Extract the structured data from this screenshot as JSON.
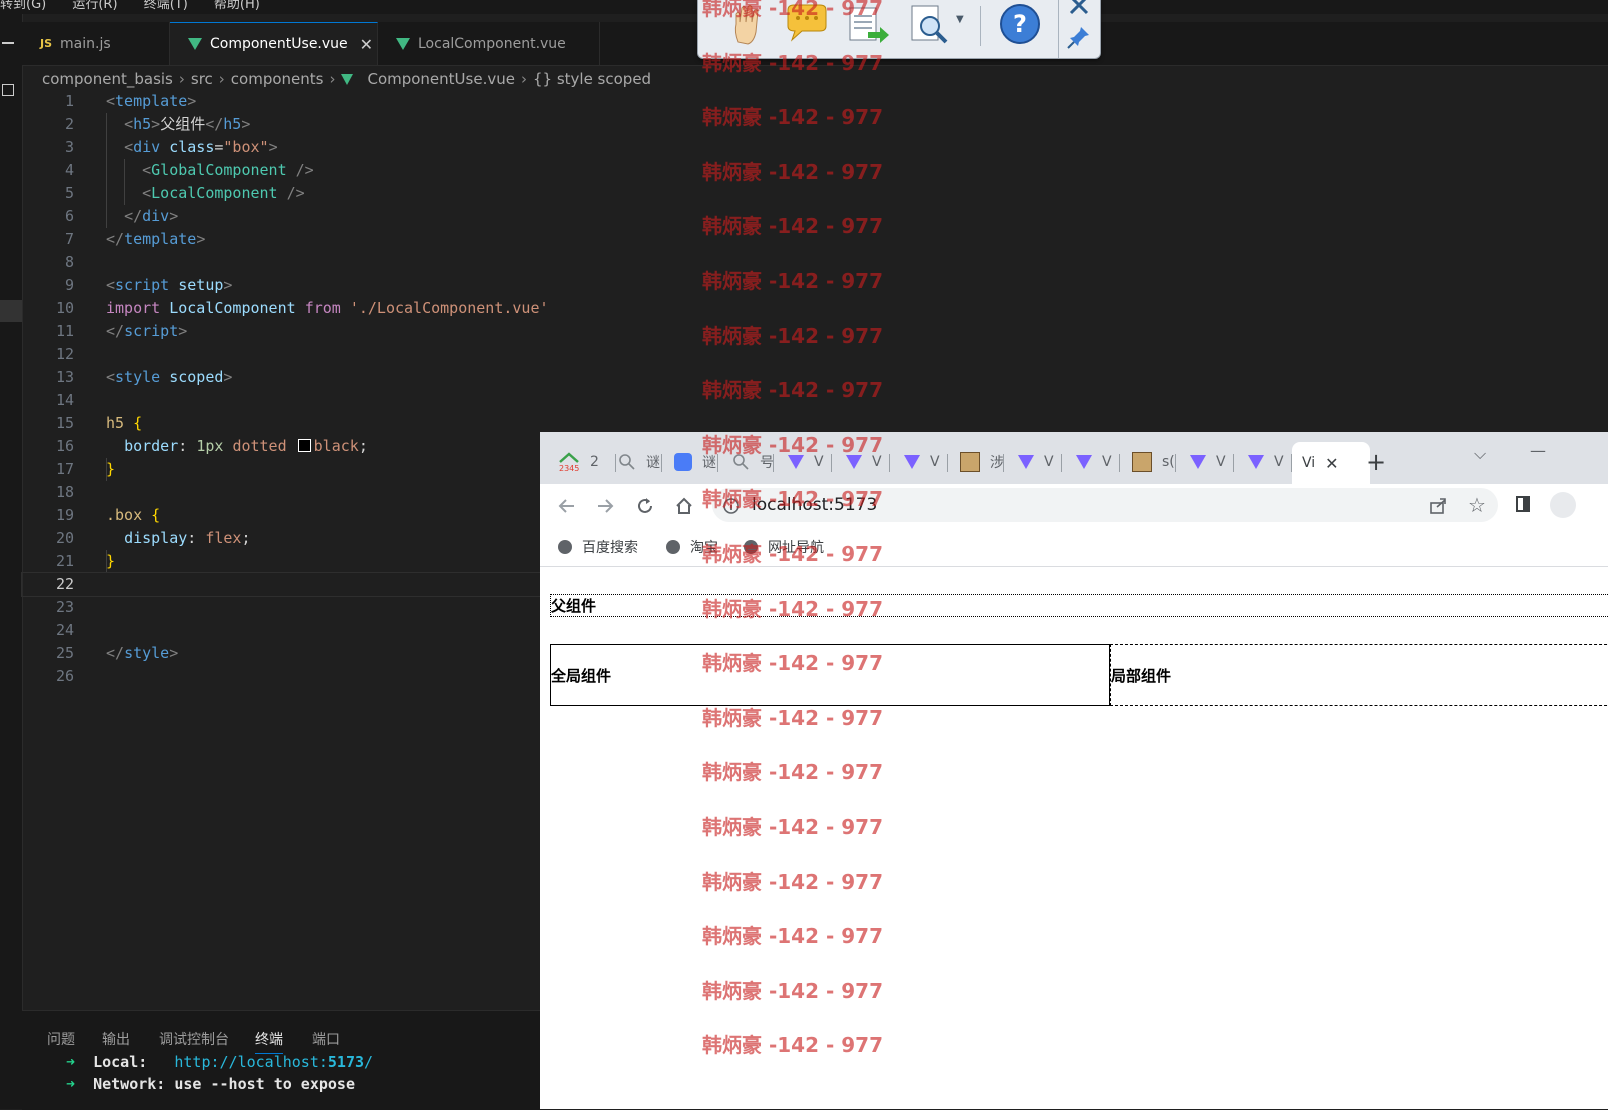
{
  "menubar": {
    "items": [
      "转到(G)",
      "运行(R)",
      "终端(T)",
      "帮助(H)"
    ]
  },
  "editor_tabs": [
    {
      "label": "main.js",
      "icon": "js-icon",
      "active": false
    },
    {
      "label": "ComponentUse.vue",
      "icon": "vue-icon",
      "active": true
    },
    {
      "label": "LocalComponent.vue",
      "icon": "vue-icon",
      "active": false
    }
  ],
  "breadcrumb": [
    "component_basis",
    "src",
    "components",
    "ComponentUse.vue",
    "{} style scoped"
  ],
  "code": {
    "current_line": 22,
    "lines": [
      {
        "n": "1",
        "tokens": [
          [
            "t-tag",
            "<"
          ],
          [
            "t-name",
            "template"
          ],
          [
            "t-tag",
            ">"
          ]
        ]
      },
      {
        "n": "2",
        "tokens": [
          [
            "t-txt",
            "  "
          ],
          [
            "t-tag",
            "<"
          ],
          [
            "t-name",
            "h5"
          ],
          [
            "t-tag",
            ">"
          ],
          [
            "t-txt",
            "父组件"
          ],
          [
            "t-tag",
            "</"
          ],
          [
            "t-name",
            "h5"
          ],
          [
            "t-tag",
            ">"
          ]
        ]
      },
      {
        "n": "3",
        "tokens": [
          [
            "t-txt",
            "  "
          ],
          [
            "t-tag",
            "<"
          ],
          [
            "t-name",
            "div"
          ],
          [
            "t-txt",
            " "
          ],
          [
            "t-attr",
            "class"
          ],
          [
            "t-txt",
            "="
          ],
          [
            "t-str",
            "\"box\""
          ],
          [
            "t-tag",
            ">"
          ]
        ]
      },
      {
        "n": "4",
        "tokens": [
          [
            "t-txt",
            "    "
          ],
          [
            "t-tag",
            "<"
          ],
          [
            "t-comp",
            "GlobalComponent"
          ],
          [
            "t-txt",
            " "
          ],
          [
            "t-tag",
            "/>"
          ]
        ]
      },
      {
        "n": "5",
        "tokens": [
          [
            "t-txt",
            "    "
          ],
          [
            "t-tag",
            "<"
          ],
          [
            "t-comp",
            "LocalComponent"
          ],
          [
            "t-txt",
            " "
          ],
          [
            "t-tag",
            "/>"
          ]
        ]
      },
      {
        "n": "6",
        "tokens": [
          [
            "t-txt",
            "  "
          ],
          [
            "t-tag",
            "</"
          ],
          [
            "t-name",
            "div"
          ],
          [
            "t-tag",
            ">"
          ]
        ]
      },
      {
        "n": "7",
        "tokens": [
          [
            "t-tag",
            "</"
          ],
          [
            "t-name",
            "template"
          ],
          [
            "t-tag",
            ">"
          ]
        ]
      },
      {
        "n": "8",
        "tokens": []
      },
      {
        "n": "9",
        "tokens": [
          [
            "t-tag",
            "<"
          ],
          [
            "t-name",
            "script"
          ],
          [
            "t-txt",
            " "
          ],
          [
            "t-attr",
            "setup"
          ],
          [
            "t-tag",
            ">"
          ]
        ]
      },
      {
        "n": "10",
        "tokens": [
          [
            "t-kw",
            "import"
          ],
          [
            "t-txt",
            " "
          ],
          [
            "t-attr",
            "LocalComponent"
          ],
          [
            "t-txt",
            " "
          ],
          [
            "t-kw",
            "from"
          ],
          [
            "t-txt",
            " "
          ],
          [
            "t-str",
            "'./LocalComponent.vue'"
          ]
        ]
      },
      {
        "n": "11",
        "tokens": [
          [
            "t-tag",
            "</"
          ],
          [
            "t-name",
            "script"
          ],
          [
            "t-tag",
            ">"
          ]
        ]
      },
      {
        "n": "12",
        "tokens": []
      },
      {
        "n": "13",
        "tokens": [
          [
            "t-tag",
            "<"
          ],
          [
            "t-name",
            "style"
          ],
          [
            "t-txt",
            " "
          ],
          [
            "t-attr",
            "scoped"
          ],
          [
            "t-tag",
            ">"
          ]
        ]
      },
      {
        "n": "14",
        "tokens": []
      },
      {
        "n": "15",
        "tokens": [
          [
            "t-sel",
            "h5"
          ],
          [
            "t-txt",
            " "
          ],
          [
            "t-brace",
            "{"
          ]
        ]
      },
      {
        "n": "16",
        "tokens": [
          [
            "t-txt",
            "  "
          ],
          [
            "t-attr",
            "border"
          ],
          [
            "t-txt",
            ": "
          ],
          [
            "t-num",
            "1px"
          ],
          [
            "t-txt",
            " "
          ],
          [
            "t-str",
            "dotted"
          ],
          [
            "t-txt",
            " "
          ],
          [
            "colorbox",
            ""
          ],
          [
            "t-str",
            "black"
          ],
          [
            "t-txt",
            ";"
          ]
        ]
      },
      {
        "n": "17",
        "tokens": [
          [
            "t-brace",
            "}"
          ]
        ]
      },
      {
        "n": "18",
        "tokens": []
      },
      {
        "n": "19",
        "tokens": [
          [
            "t-sel",
            ".box"
          ],
          [
            "t-txt",
            " "
          ],
          [
            "t-brace",
            "{"
          ]
        ]
      },
      {
        "n": "20",
        "tokens": [
          [
            "t-txt",
            "  "
          ],
          [
            "t-attr",
            "display"
          ],
          [
            "t-txt",
            ": "
          ],
          [
            "t-str",
            "flex"
          ],
          [
            "t-txt",
            ";"
          ]
        ]
      },
      {
        "n": "21",
        "tokens": [
          [
            "t-brace",
            "}"
          ]
        ]
      },
      {
        "n": "22",
        "tokens": []
      },
      {
        "n": "23",
        "tokens": []
      },
      {
        "n": "24",
        "tokens": []
      },
      {
        "n": "25",
        "tokens": [
          [
            "t-tag",
            "</"
          ],
          [
            "t-name",
            "style"
          ],
          [
            "t-tag",
            ">"
          ]
        ]
      },
      {
        "n": "26",
        "tokens": []
      }
    ]
  },
  "panel": {
    "tabs": [
      "问题",
      "输出",
      "调试控制台",
      "终端",
      "端口"
    ],
    "active_tab": "终端",
    "terminal": {
      "local_label": "Local:",
      "local_url": "http://localhost:",
      "local_port": "5173",
      "local_suffix": "/",
      "network_line": "Network: use --host to expose"
    }
  },
  "browser": {
    "tabs": [
      "2",
      "谜",
      "谜",
      "号",
      "V",
      "V",
      "V",
      "涉",
      "V",
      "V",
      "s(",
      "V",
      "V",
      "Vi"
    ],
    "new_tab_label": "+",
    "url": "localhost:5173",
    "bookmarks": [
      "百度搜索",
      "淘宝",
      "网址导航"
    ],
    "page": {
      "h5": "父组件",
      "global_component": "全局组件",
      "local_component": "局部组件"
    }
  },
  "watermark": {
    "text": "韩炳豪 -142 - 977",
    "color": "#c81e1e"
  }
}
